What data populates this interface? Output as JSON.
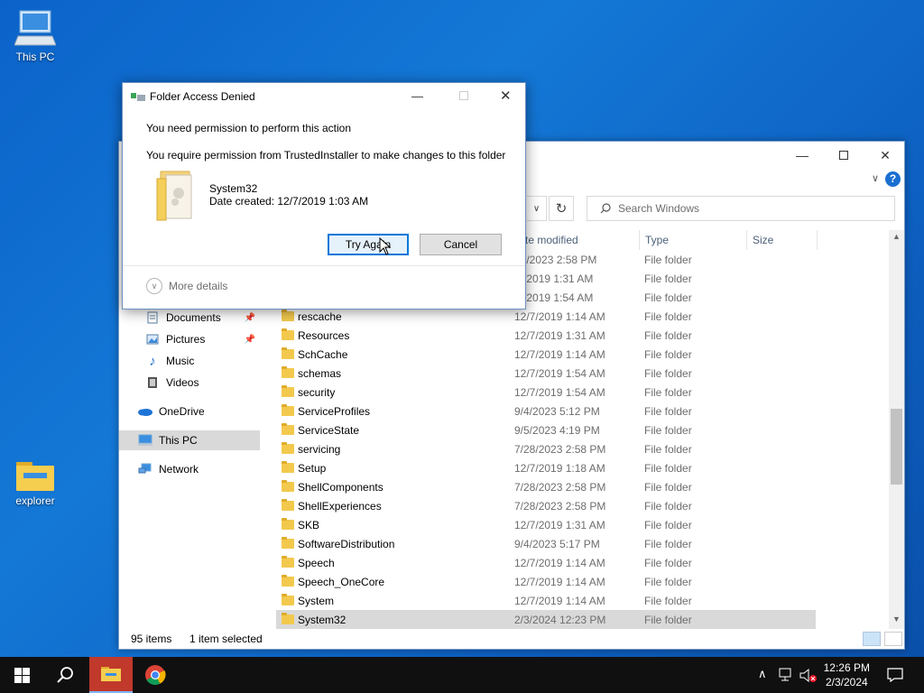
{
  "desktop": {
    "icons": [
      {
        "label": "This PC"
      },
      {
        "label": "explorer"
      }
    ]
  },
  "explorer": {
    "search_placeholder": "Search Windows",
    "columns": {
      "date": "te modified",
      "type": "Type",
      "size": "Size"
    },
    "nav": {
      "documents": "Documents",
      "pictures": "Pictures",
      "music": "Music",
      "videos": "Videos",
      "onedrive": "OneDrive",
      "thispc": "This PC",
      "network": "Network"
    },
    "rows": [
      {
        "name": "",
        "date": "28/2023 2:58 PM",
        "type": "File folder"
      },
      {
        "name": "",
        "date": "/7/2019 1:31 AM",
        "type": "File folder"
      },
      {
        "name": "",
        "date": "/7/2019 1:54 AM",
        "type": "File folder"
      },
      {
        "name": "rescache",
        "date": "12/7/2019 1:14 AM",
        "type": "File folder"
      },
      {
        "name": "Resources",
        "date": "12/7/2019 1:31 AM",
        "type": "File folder"
      },
      {
        "name": "SchCache",
        "date": "12/7/2019 1:14 AM",
        "type": "File folder"
      },
      {
        "name": "schemas",
        "date": "12/7/2019 1:54 AM",
        "type": "File folder"
      },
      {
        "name": "security",
        "date": "12/7/2019 1:54 AM",
        "type": "File folder"
      },
      {
        "name": "ServiceProfiles",
        "date": "9/4/2023 5:12 PM",
        "type": "File folder"
      },
      {
        "name": "ServiceState",
        "date": "9/5/2023 4:19 PM",
        "type": "File folder"
      },
      {
        "name": "servicing",
        "date": "7/28/2023 2:58 PM",
        "type": "File folder"
      },
      {
        "name": "Setup",
        "date": "12/7/2019 1:18 AM",
        "type": "File folder"
      },
      {
        "name": "ShellComponents",
        "date": "7/28/2023 2:58 PM",
        "type": "File folder"
      },
      {
        "name": "ShellExperiences",
        "date": "7/28/2023 2:58 PM",
        "type": "File folder"
      },
      {
        "name": "SKB",
        "date": "12/7/2019 1:31 AM",
        "type": "File folder"
      },
      {
        "name": "SoftwareDistribution",
        "date": "9/4/2023 5:17 PM",
        "type": "File folder"
      },
      {
        "name": "Speech",
        "date": "12/7/2019 1:14 AM",
        "type": "File folder"
      },
      {
        "name": "Speech_OneCore",
        "date": "12/7/2019 1:14 AM",
        "type": "File folder"
      },
      {
        "name": "System",
        "date": "12/7/2019 1:14 AM",
        "type": "File folder"
      },
      {
        "name": "System32",
        "date": "2/3/2024 12:23 PM",
        "type": "File folder"
      }
    ],
    "status": {
      "items": "95 items",
      "selected": "1 item selected"
    }
  },
  "dialog": {
    "title": "Folder Access Denied",
    "line1": "You need permission to perform this action",
    "line2": "You require permission from TrustedInstaller to make changes to this folder",
    "folder_name": "System32",
    "date_created": "Date created: 12/7/2019 1:03 AM",
    "try_again": "Try Again",
    "cancel": "Cancel",
    "more_details": "More details"
  },
  "taskbar": {
    "time": "12:26 PM",
    "date": "2/3/2024"
  },
  "colors": {
    "accent": "#0078d7",
    "desktop": "#1478d6",
    "taskbar": "#101010",
    "selection": "#d9d9d9"
  }
}
